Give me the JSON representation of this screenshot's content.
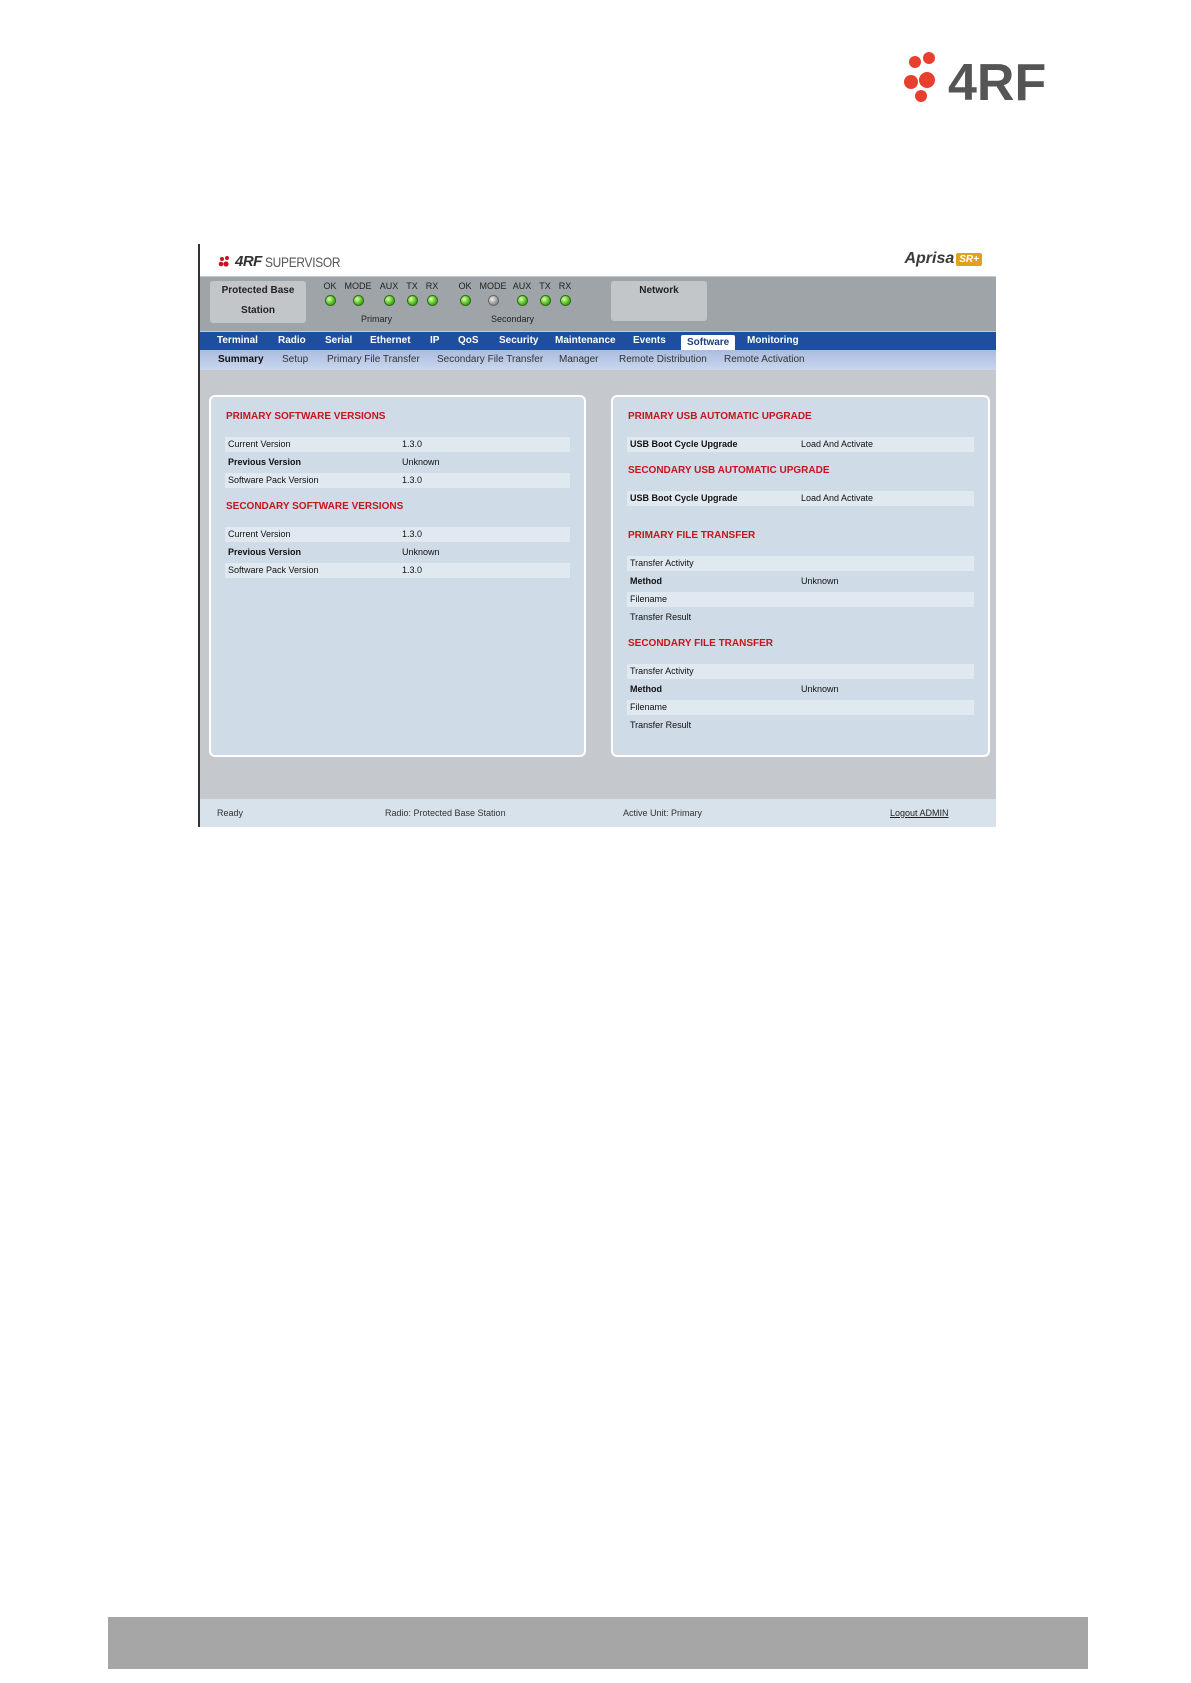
{
  "logo": {
    "text": "4RF",
    "colors": {
      "red": "#e8402e",
      "grey": "#555555"
    }
  },
  "app": {
    "brand": "4RF",
    "title": "SUPERVISOR",
    "product": "Aprisa",
    "product_badge": "SR+"
  },
  "status": {
    "station_line1": "Protected Base",
    "station_line2": "Station",
    "network": "Network",
    "primary_label": "Primary",
    "secondary_label": "Secondary",
    "primary_leds": [
      {
        "label": "OK",
        "state": "green"
      },
      {
        "label": "MODE",
        "state": "green"
      },
      {
        "label": "AUX",
        "state": "green"
      },
      {
        "label": "TX",
        "state": "green"
      },
      {
        "label": "RX",
        "state": "green"
      }
    ],
    "secondary_leds": [
      {
        "label": "OK",
        "state": "green"
      },
      {
        "label": "MODE",
        "state": "grey"
      },
      {
        "label": "AUX",
        "state": "green"
      },
      {
        "label": "TX",
        "state": "green"
      },
      {
        "label": "RX",
        "state": "green"
      }
    ]
  },
  "nav": [
    "Terminal",
    "Radio",
    "Serial",
    "Ethernet",
    "IP",
    "QoS",
    "Security",
    "Maintenance",
    "Events",
    "Software",
    "Monitoring"
  ],
  "nav_active": "Software",
  "subnav": [
    "Summary",
    "Setup",
    "Primary File Transfer",
    "Secondary File Transfer",
    "Manager",
    "Remote Distribution",
    "Remote Activation"
  ],
  "subnav_active": "Summary",
  "left": {
    "primary_title": "PRIMARY SOFTWARE VERSIONS",
    "primary_rows": [
      {
        "k": "Current Version",
        "v": "1.3.0"
      },
      {
        "k": "Previous Version",
        "v": "Unknown"
      },
      {
        "k": "Software Pack Version",
        "v": "1.3.0"
      }
    ],
    "secondary_title": "SECONDARY SOFTWARE VERSIONS",
    "secondary_rows": [
      {
        "k": "Current Version",
        "v": "1.3.0"
      },
      {
        "k": "Previous Version",
        "v": "Unknown"
      },
      {
        "k": "Software Pack Version",
        "v": "1.3.0"
      }
    ]
  },
  "right": {
    "usb_primary_title": "PRIMARY USB AUTOMATIC UPGRADE",
    "usb_primary_row": {
      "k": "USB Boot Cycle Upgrade",
      "v": "Load And Activate"
    },
    "usb_secondary_title": "SECONDARY USB AUTOMATIC UPGRADE",
    "usb_secondary_row": {
      "k": "USB Boot Cycle Upgrade",
      "v": "Load And Activate"
    },
    "pft_title": "PRIMARY FILE TRANSFER",
    "pft_rows": [
      {
        "k": "Transfer Activity",
        "v": ""
      },
      {
        "k": "Method",
        "v": "Unknown"
      },
      {
        "k": "Filename",
        "v": ""
      },
      {
        "k": "Transfer Result",
        "v": ""
      }
    ],
    "sft_title": "SECONDARY FILE TRANSFER",
    "sft_rows": [
      {
        "k": "Transfer Activity",
        "v": ""
      },
      {
        "k": "Method",
        "v": "Unknown"
      },
      {
        "k": "Filename",
        "v": ""
      },
      {
        "k": "Transfer Result",
        "v": ""
      }
    ]
  },
  "footer": {
    "ready": "Ready",
    "radio": "Radio: Protected Base Station",
    "active_unit": "Active Unit: Primary",
    "logout": "Logout ADMIN"
  }
}
